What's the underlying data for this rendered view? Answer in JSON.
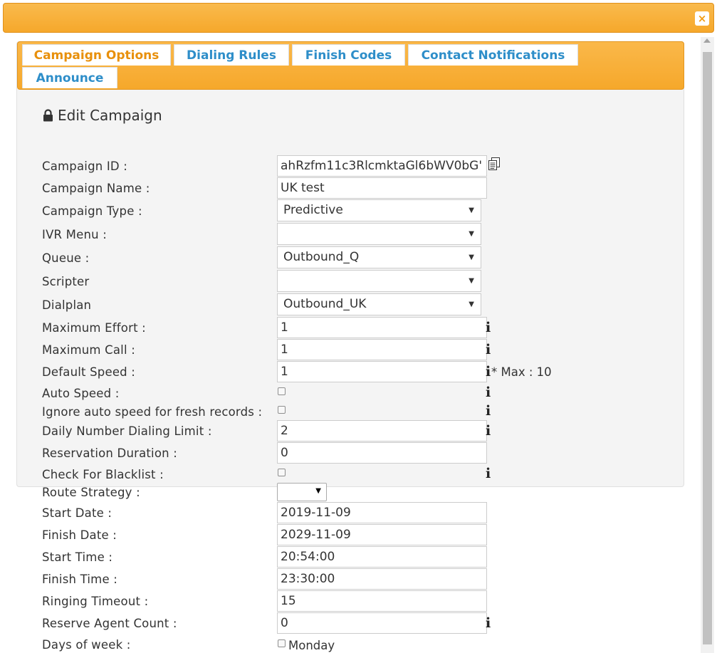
{
  "dialog": {
    "close_label": "×"
  },
  "tabs": [
    {
      "label": "Campaign Options"
    },
    {
      "label": "Dialing Rules"
    },
    {
      "label": "Finish Codes"
    },
    {
      "label": "Contact Notifications"
    },
    {
      "label": "Announce"
    }
  ],
  "form": {
    "title": "Edit Campaign",
    "campaign_id": {
      "label": "Campaign ID :",
      "value": "ahRzfm11c3RlcmktaGl6bWV0bG'"
    },
    "campaign_name": {
      "label": "Campaign Name :",
      "value": "UK test"
    },
    "campaign_type": {
      "label": "Campaign Type :",
      "value": "Predictive"
    },
    "ivr_menu": {
      "label": "IVR Menu :",
      "value": ""
    },
    "queue": {
      "label": "Queue :",
      "value": "Outbound_Q"
    },
    "scripter": {
      "label": "Scripter",
      "value": ""
    },
    "dialplan": {
      "label": "Dialplan",
      "value": "Outbound_UK"
    },
    "maximum_effort": {
      "label": "Maximum Effort :",
      "value": "1"
    },
    "maximum_call": {
      "label": "Maximum Call :",
      "value": "1"
    },
    "default_speed": {
      "label": "Default Speed :",
      "value": "1",
      "note": "* Max : 10"
    },
    "auto_speed": {
      "label": "Auto Speed :",
      "checked": false
    },
    "ignore_auto_speed": {
      "label": "Ignore auto speed for fresh records :",
      "checked": false
    },
    "daily_limit": {
      "label": "Daily Number Dialing Limit :",
      "value": "2"
    },
    "reservation_duration": {
      "label": "Reservation Duration :",
      "value": "0"
    },
    "check_blacklist": {
      "label": "Check For Blacklist :",
      "checked": false
    },
    "route_strategy": {
      "label": "Route Strategy :",
      "value": ""
    },
    "start_date": {
      "label": "Start Date :",
      "value": "2019-11-09"
    },
    "finish_date": {
      "label": "Finish Date :",
      "value": "2029-11-09"
    },
    "start_time": {
      "label": "Start Time :",
      "value": "20:54:00"
    },
    "finish_time": {
      "label": "Finish Time :",
      "value": "23:30:00"
    },
    "ringing_timeout": {
      "label": "Ringing Timeout :",
      "value": "15"
    },
    "reserve_agent_count": {
      "label": "Reserve Agent Count :",
      "value": "0"
    },
    "days_of_week": {
      "label": "Days of week :",
      "first_day": "Monday",
      "checked": false
    }
  },
  "info_glyph": "i",
  "colors": {
    "accent": "#f6a82b",
    "tab_text": "#2e8ec9",
    "active_tab_text": "#e8900c"
  }
}
